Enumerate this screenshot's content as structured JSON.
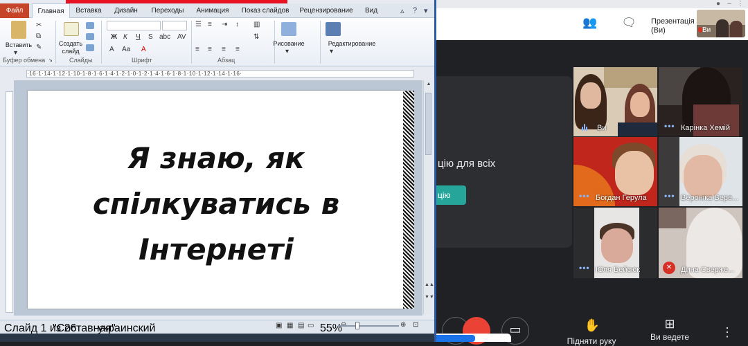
{
  "meet": {
    "presentation_label": "Презентація (Ви)",
    "presentation_self": "Ви",
    "notice_text": "цію для всіх",
    "notice_button": "цію",
    "participants": [
      {
        "name": "Ви"
      },
      {
        "name": "Карінка Хемій"
      },
      {
        "name": "Богдан Герула"
      },
      {
        "name": "Вероніка Вере..."
      },
      {
        "name": "Юля Бейсюк"
      },
      {
        "name": "Дина Сверже..."
      }
    ],
    "controls": {
      "raise_hand": "Підняти руку",
      "present": "Ви ведете"
    },
    "colors": {
      "accent_teal": "#26a69a",
      "mic_off": "#d93025",
      "active_blue": "#8ab4f8"
    }
  },
  "ppt": {
    "tabs": [
      "Файл",
      "Главная",
      "Вставка",
      "Дизайн",
      "Переходы",
      "Анимация",
      "Показ слайдов",
      "Рецензирование",
      "Вид"
    ],
    "active_tab": "Главная",
    "ribbon": {
      "paste": "Вставить",
      "new_slide_1": "Создать",
      "new_slide_2": "слайд",
      "drawing": "Рисование",
      "editing": "Редактирование",
      "groups": [
        "Буфер обмена",
        "Слайды",
        "Шрифт",
        "Абзац"
      ]
    },
    "ruler_text": "·16·1·14·1·12·1·10·1·8·1·6·1·4·1·2·1·0·1·2·1·4·1·6·1·8·1·10·1·12·1·14·1·16·",
    "slide_lines": [
      "Я знаю, як",
      "спілкуватись в",
      "Інтернеті"
    ],
    "status": {
      "slide_info": "Слайд 1 из 26",
      "theme": "\"Составная\"",
      "language": "украинский",
      "zoom": "55%"
    }
  }
}
